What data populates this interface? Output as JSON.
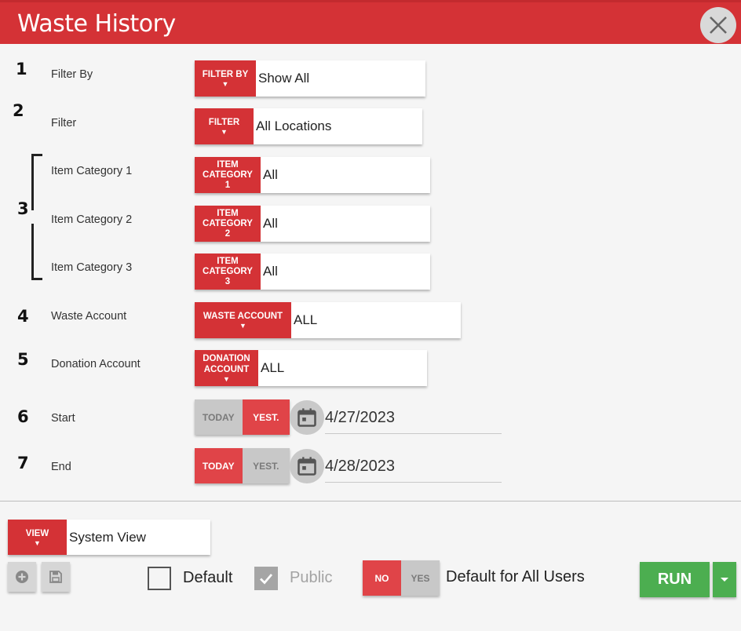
{
  "window": {
    "title": "Waste History"
  },
  "rows": [
    {
      "num": "1",
      "label": "Filter By",
      "tag": [
        "FILTER BY"
      ],
      "value": "Show All"
    },
    {
      "num": "2",
      "label": "Filter",
      "tag": [
        "FILTER"
      ],
      "value": "All Locations"
    },
    {
      "num": "",
      "label": "Item Category 1",
      "tag": [
        "ITEM",
        "CATEGORY",
        "1"
      ],
      "value": "All"
    },
    {
      "num": "3",
      "label": "Item Category 2",
      "tag": [
        "ITEM",
        "CATEGORY",
        "2"
      ],
      "value": "All"
    },
    {
      "num": "",
      "label": "Item Category 3",
      "tag": [
        "ITEM",
        "CATEGORY",
        "3"
      ],
      "value": "All"
    },
    {
      "num": "4",
      "label": "Waste Account",
      "tag": [
        "WASTE ACCOUNT"
      ],
      "value": "ALL"
    },
    {
      "num": "5",
      "label": "Donation Account",
      "tag": [
        "DONATION",
        "ACCOUNT"
      ],
      "value": "ALL"
    }
  ],
  "start": {
    "num": "6",
    "label": "Start",
    "today": "TODAY",
    "yest": "YEST.",
    "active": "yest",
    "date": "4/27/2023"
  },
  "end": {
    "num": "7",
    "label": "End",
    "today": "TODAY",
    "yest": "YEST.",
    "active": "today",
    "date": "4/28/2023"
  },
  "view": {
    "tag": "VIEW",
    "value": "System View"
  },
  "default_label": "Default",
  "default_checked": false,
  "public_label": "Public",
  "public_checked": true,
  "all_users": {
    "no": "NO",
    "yes": "YES",
    "active": "no",
    "label": "Default for All Users"
  },
  "run_label": "RUN",
  "icons": {
    "close": "close-icon",
    "calendar": "calendar-icon",
    "add": "plus-circle-icon",
    "save": "save-icon",
    "dropdown": "caret-down-icon"
  },
  "colors": {
    "accent": "#d43236",
    "run": "#4cae50",
    "toggle_on": "#e04448",
    "toggle_off": "#c8c8c8"
  }
}
